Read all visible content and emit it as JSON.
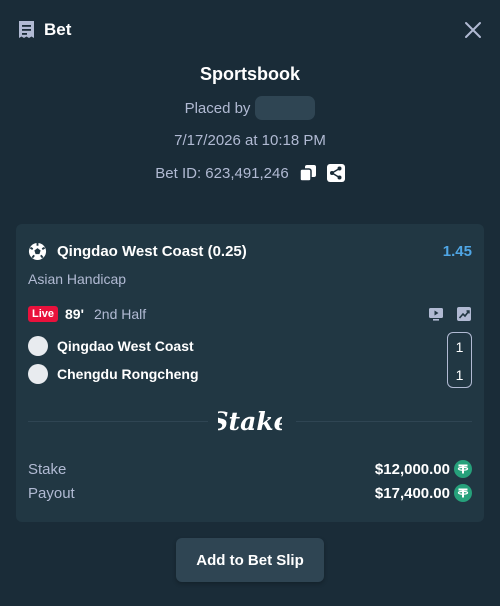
{
  "header": {
    "title": "Bet",
    "icon": "receipt-icon",
    "close_icon": "close-icon"
  },
  "bet_info": {
    "sportsbook_label": "Sportsbook",
    "placed_by_label": "Placed by",
    "date": "7/17/2026 at 10:18 PM",
    "bet_id": "Bet ID: 623,491,246"
  },
  "selection": {
    "name": "Qingdao West Coast (0.25)",
    "odds": "1.45",
    "market": "Asian Handicap",
    "sport_icon": "soccer-ball-icon"
  },
  "match": {
    "live_label": "Live",
    "minute": "89'",
    "period": "2nd Half",
    "teams": [
      {
        "name": "Qingdao West Coast",
        "score": "1"
      },
      {
        "name": "Chengdu Rongcheng",
        "score": "1"
      }
    ]
  },
  "brand": {
    "logo_text": "Stake"
  },
  "totals": {
    "stake_label": "Stake",
    "stake_value": "$12,000.00",
    "payout_label": "Payout",
    "payout_value": "$17,400.00",
    "currency_icon": "tether-icon"
  },
  "actions": {
    "add_to_slip": "Add to Bet Slip"
  },
  "colors": {
    "background": "#1a2c38",
    "card": "#213743",
    "accent_blue": "#4fa6e5",
    "live_red": "#e9113c",
    "tether_green": "#26a17b",
    "muted_text": "#b1bad3"
  }
}
